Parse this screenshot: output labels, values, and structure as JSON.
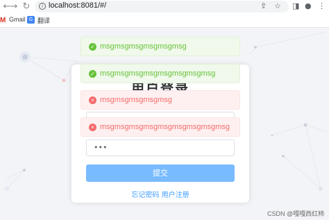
{
  "browser": {
    "url": "localhost:8081/#/",
    "bookmarks": [
      {
        "label": "Gmail",
        "icon": "gmail-icon"
      },
      {
        "label": "翻译",
        "icon": "translate-icon"
      }
    ]
  },
  "login": {
    "title": "用户登录",
    "password_value": "•••",
    "submit_label": "提交",
    "forgot_label": "忘记密码",
    "register_label": "用户注册"
  },
  "messages": [
    {
      "type": "success",
      "text": "msgmsgmsgmsgmsgmsg"
    },
    {
      "type": "success",
      "text": "msgmsgmsgmsgmsgmsgmsgmsg"
    },
    {
      "type": "error",
      "text": "msgmsgmsgmsgmsg"
    },
    {
      "type": "error",
      "text": "msgmsgmsgmsgmsgmsgmsgmsgmsg"
    }
  ],
  "watermark": "CSDN @嘎嘎西红柿",
  "colors": {
    "success": "#67c23a",
    "error": "#f56c6c",
    "primary": "#409eff",
    "submit_bg": "#79bbff"
  }
}
